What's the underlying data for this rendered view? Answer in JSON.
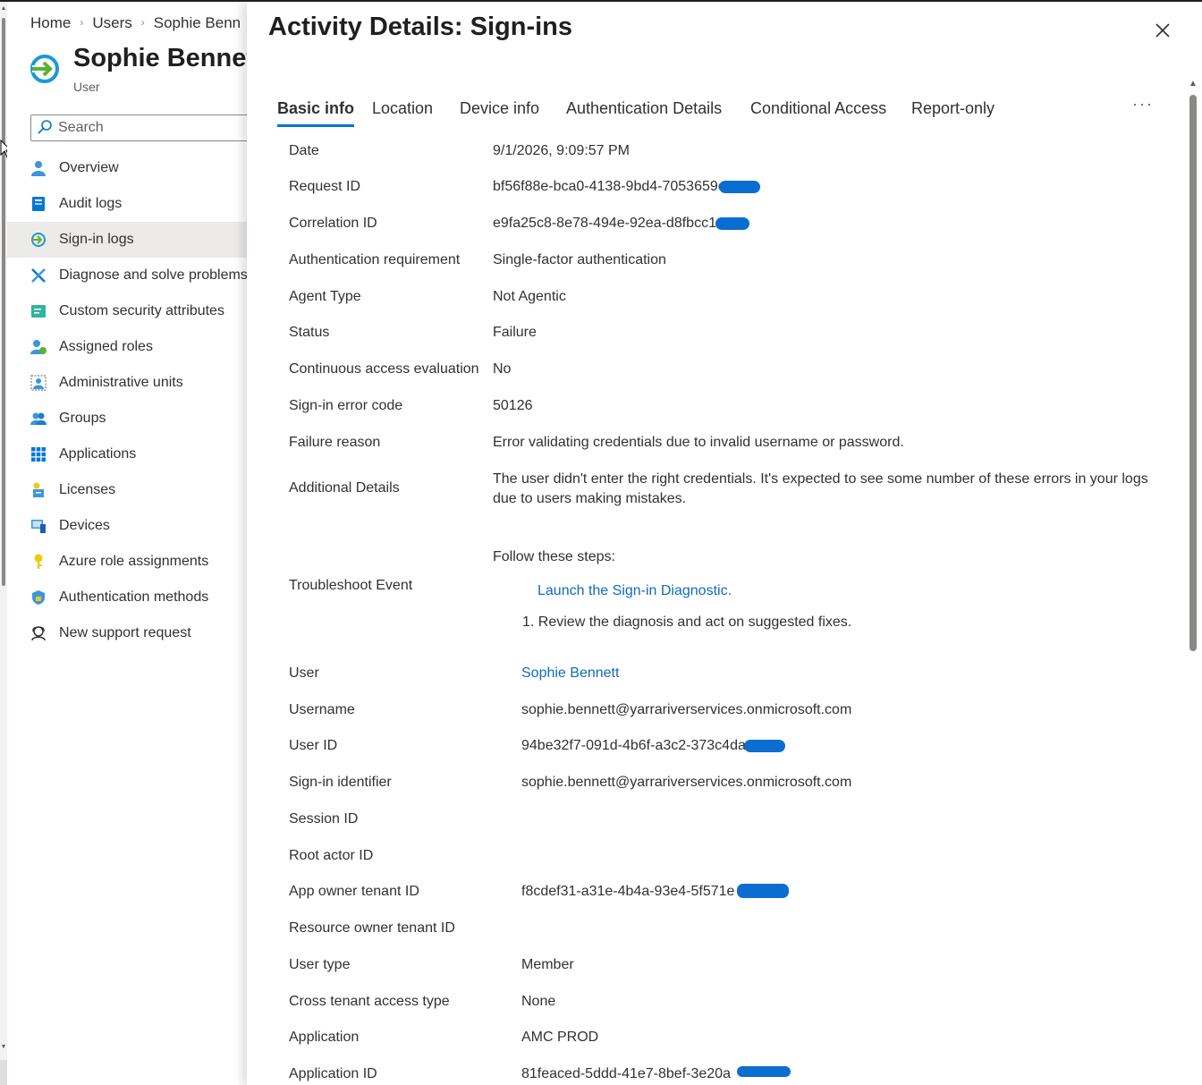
{
  "breadcrumb": [
    "Home",
    "Users",
    "Sophie Benn"
  ],
  "blade": {
    "title": "Sophie Bennet",
    "subtitle": "User",
    "search_placeholder": "Search"
  },
  "nav": [
    {
      "label": "Overview",
      "icon": "overview-icon"
    },
    {
      "label": "Audit logs",
      "icon": "audit-logs-icon"
    },
    {
      "label": "Sign-in logs",
      "icon": "sign-in-logs-icon",
      "active": true
    },
    {
      "label": "Diagnose and solve problems",
      "icon": "diagnose-icon"
    },
    {
      "label": "Custom security attributes",
      "icon": "custom-security-icon"
    },
    {
      "label": "Assigned roles",
      "icon": "assigned-roles-icon"
    },
    {
      "label": "Administrative units",
      "icon": "administrative-units-icon"
    },
    {
      "label": "Groups",
      "icon": "groups-icon"
    },
    {
      "label": "Applications",
      "icon": "applications-icon"
    },
    {
      "label": "Licenses",
      "icon": "licenses-icon"
    },
    {
      "label": "Devices",
      "icon": "devices-icon"
    },
    {
      "label": "Azure role assignments",
      "icon": "key-icon"
    },
    {
      "label": "Authentication methods",
      "icon": "shield-icon"
    },
    {
      "label": "New support request",
      "icon": "support-icon"
    }
  ],
  "panel": {
    "title": "Activity Details: Sign-ins",
    "tabs": [
      "Basic info",
      "Location",
      "Device info",
      "Authentication Details",
      "Conditional Access",
      "Report-only"
    ],
    "more": "···"
  },
  "details": {
    "date_label": "Date",
    "date_value": "9/1/2026, 9:09:57 PM",
    "request_id_label": "Request ID",
    "request_id_value": "bf56f88e-bca0-4138-9bd4-7053659c",
    "correlation_id_label": "Correlation ID",
    "correlation_id_value": "e9fa25c8-8e78-494e-92ea-d8fbcc1",
    "auth_req_label": "Authentication requirement",
    "auth_req_value": "Single-factor authentication",
    "agent_type_label": "Agent Type",
    "agent_type_value": "Not Agentic",
    "status_label": "Status",
    "status_value": "Failure",
    "cae_label": "Continuous access evaluation",
    "cae_value": "No",
    "error_code_label": "Sign-in error code",
    "error_code_value": "50126",
    "failure_reason_label": "Failure reason",
    "failure_reason_value": "Error validating credentials due to invalid username or password.",
    "additional_details_label": "Additional Details",
    "additional_details_value": "The user didn't enter the right credentials.  It's expected to see some number of these errors in your logs due to users making mistakes.",
    "troubleshoot_label": "Troubleshoot Event",
    "follow_steps": "Follow these steps:",
    "launch_link": "Launch the Sign-in Diagnostic.",
    "review_step": "1. Review the diagnosis and act on suggested fixes.",
    "user_label": "User",
    "user_value": "Sophie Bennett",
    "username_label": "Username",
    "username_value": "sophie.bennett@yarrariverservices.onmicrosoft.com",
    "user_id_label": "User ID",
    "user_id_value": "94be32f7-091d-4b6f-a3c2-373c4da",
    "signin_identifier_label": "Sign-in identifier",
    "signin_identifier_value": "sophie.bennett@yarrariverservices.onmicrosoft.com",
    "session_id_label": "Session ID",
    "root_actor_label": "Root actor ID",
    "app_owner_tenant_label": "App owner tenant ID",
    "app_owner_tenant_value": "f8cdef31-a31e-4b4a-93e4-5f571e",
    "resource_owner_tenant_label": "Resource owner tenant ID",
    "user_type_label": "User type",
    "user_type_value": "Member",
    "cross_tenant_label": "Cross tenant access type",
    "cross_tenant_value": "None",
    "application_label": "Application",
    "application_value": "AMC PROD",
    "application_id_label": "Application ID",
    "application_id_value": "81feaced-5ddd-41e7-8bef-3e20a"
  },
  "colors": {
    "accent": "#0078d4",
    "link": "#0f6cbd",
    "redaction": "#0a6ed1"
  }
}
